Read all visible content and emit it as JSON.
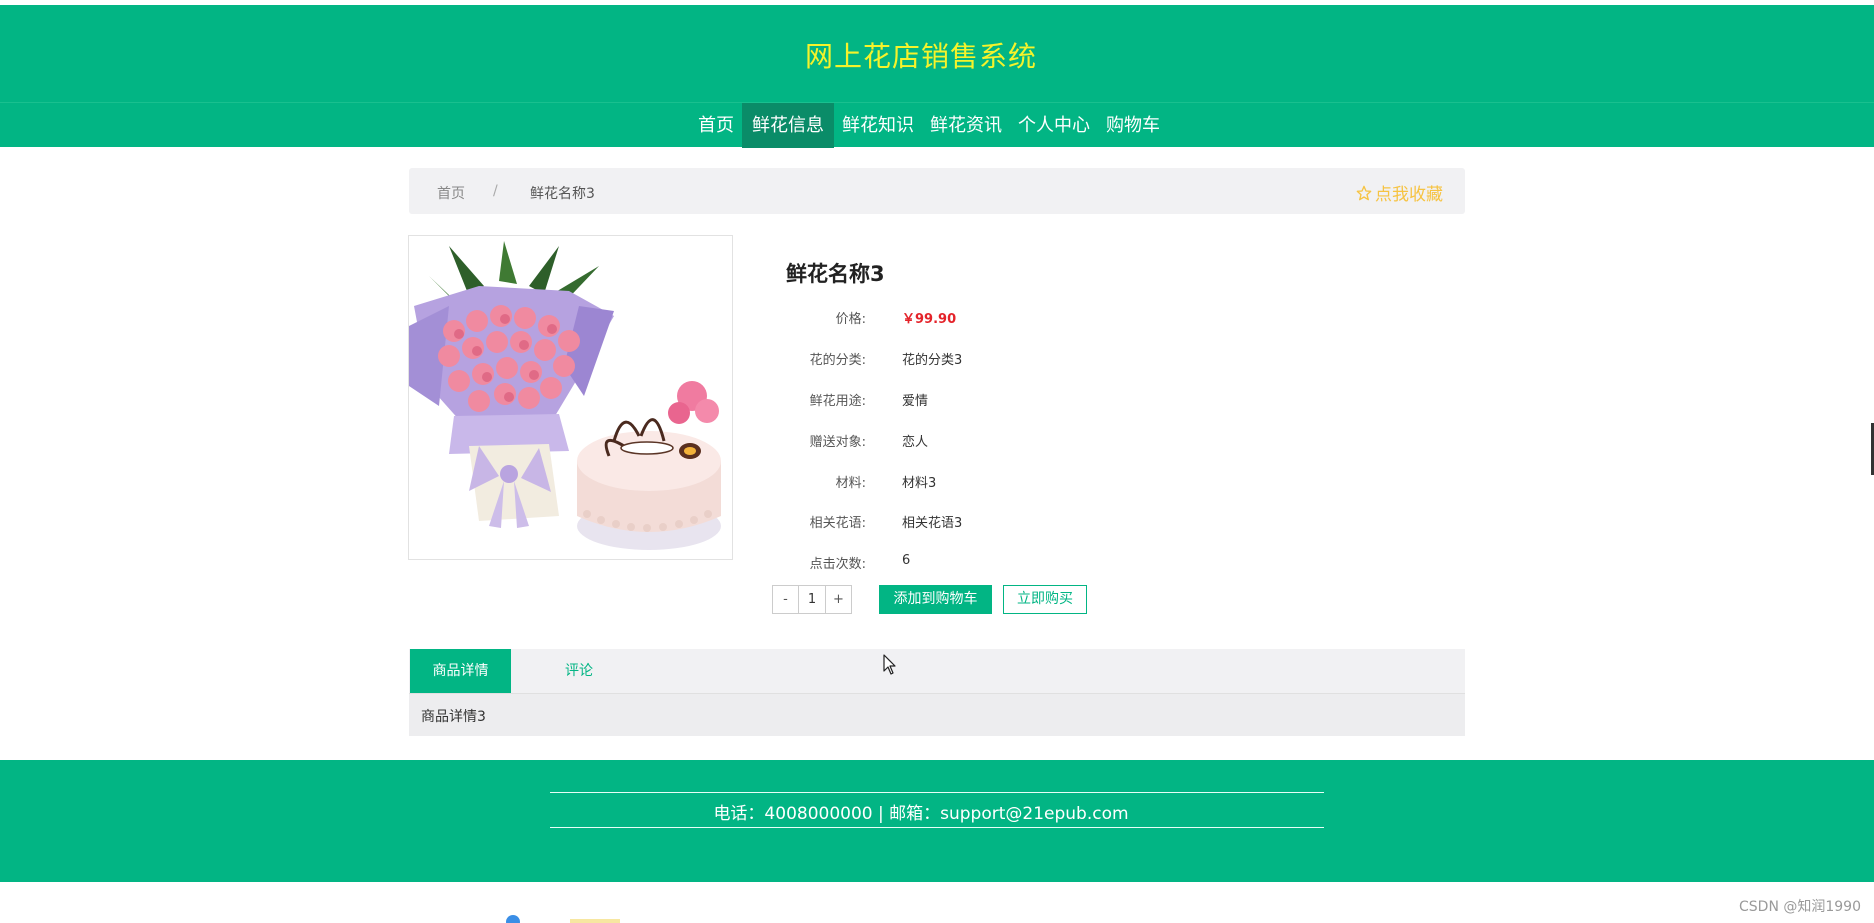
{
  "header": {
    "site_title": "网上花店销售系统"
  },
  "nav": {
    "items": [
      {
        "label": "首页",
        "name": "nav-item-home",
        "active": false
      },
      {
        "label": "鲜花信息",
        "name": "nav-item-flower-info",
        "active": true
      },
      {
        "label": "鲜花知识",
        "name": "nav-item-flower-knowledge",
        "active": false
      },
      {
        "label": "鲜花资讯",
        "name": "nav-item-flower-news",
        "active": false
      },
      {
        "label": "个人中心",
        "name": "nav-item-personal-center",
        "active": false
      },
      {
        "label": "购物车",
        "name": "nav-item-cart",
        "active": false
      }
    ]
  },
  "breadcrumb": {
    "home": "首页",
    "separator": "/",
    "current": "鲜花名称3",
    "favorite_label": "点我收藏"
  },
  "product": {
    "name": "鲜花名称3",
    "fields": [
      {
        "label": "价格:",
        "value": "￥99.90",
        "type": "price"
      },
      {
        "label": "花的分类:",
        "value": "花的分类3",
        "type": "text"
      },
      {
        "label": "鲜花用途:",
        "value": "爱情",
        "type": "text"
      },
      {
        "label": "赠送对象:",
        "value": "恋人",
        "type": "text"
      },
      {
        "label": "材料:",
        "value": "材料3",
        "type": "text"
      },
      {
        "label": "相关花语:",
        "value": "相关花语3",
        "type": "text"
      },
      {
        "label": "点击次数:",
        "value": "6",
        "type": "text"
      }
    ]
  },
  "purchase": {
    "minus": "-",
    "quantity": "1",
    "plus": "+",
    "add_to_cart": "添加到购物车",
    "buy_now": "立即购买"
  },
  "tabs": {
    "items": [
      {
        "label": "商品详情",
        "active": true
      },
      {
        "label": "评论",
        "active": false
      }
    ],
    "content": "商品详情3"
  },
  "footer": {
    "contact": "电话：4008000000 | 邮箱：support@21epub.com"
  },
  "watermark": "CSDN @知润1990",
  "colors": {
    "brand": "#02b584",
    "title": "#f5f32b",
    "price": "#e4232a",
    "favorite": "#f6c342"
  }
}
